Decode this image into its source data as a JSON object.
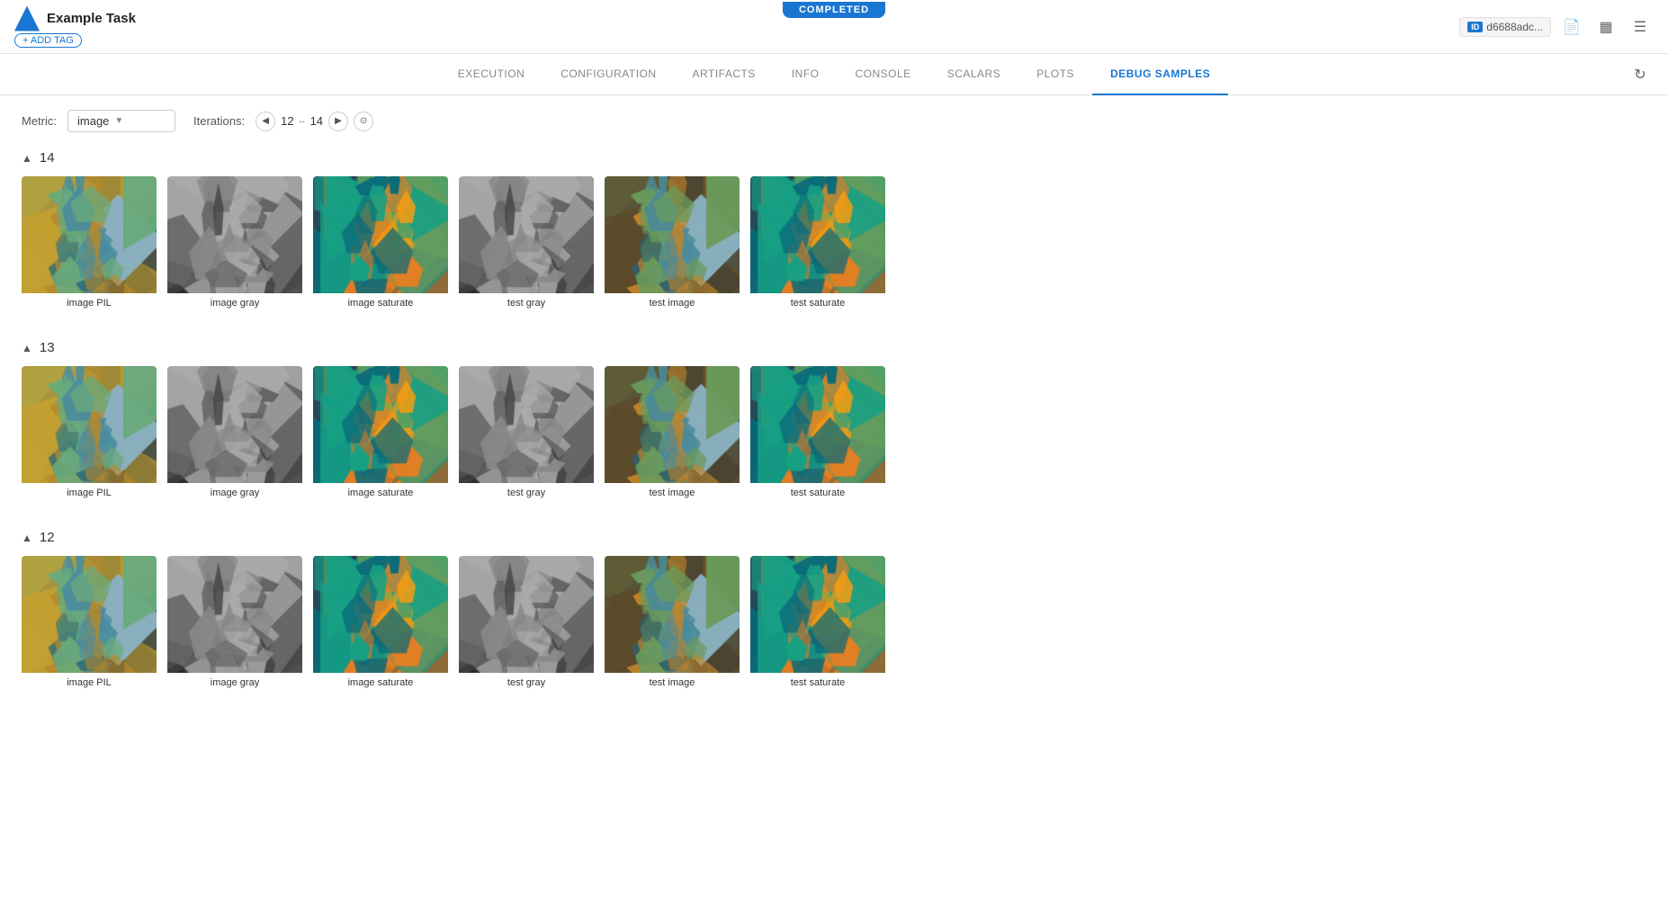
{
  "completed_badge": "COMPLETED",
  "header": {
    "logo_text": "Example Task",
    "add_tag_label": "+ ADD TAG",
    "id_label": "ID",
    "id_value": "d6688adc...",
    "title": "Example Task"
  },
  "nav": {
    "tabs": [
      {
        "id": "execution",
        "label": "EXECUTION",
        "active": false
      },
      {
        "id": "configuration",
        "label": "CONFIGURATION",
        "active": false
      },
      {
        "id": "artifacts",
        "label": "ARTIFACTS",
        "active": false
      },
      {
        "id": "info",
        "label": "INFO",
        "active": false
      },
      {
        "id": "console",
        "label": "CONSOLE",
        "active": false
      },
      {
        "id": "scalars",
        "label": "SCALARS",
        "active": false
      },
      {
        "id": "plots",
        "label": "PLOTS",
        "active": false
      },
      {
        "id": "debug_samples",
        "label": "DEBUG SAMPLES",
        "active": true
      }
    ]
  },
  "metric_bar": {
    "metric_label": "Metric:",
    "metric_value": "image",
    "iterations_label": "Iterations:",
    "iter_from": "12",
    "iter_to": "14"
  },
  "groups": [
    {
      "id": "group-14",
      "number": "14",
      "expanded": true,
      "images": [
        {
          "label": "image PIL",
          "type": "color"
        },
        {
          "label": "image gray",
          "type": "gray"
        },
        {
          "label": "image saturate",
          "type": "saturate"
        },
        {
          "label": "test gray",
          "type": "gray"
        },
        {
          "label": "test image",
          "type": "color2"
        },
        {
          "label": "test saturate",
          "type": "saturate2"
        }
      ]
    },
    {
      "id": "group-13",
      "number": "13",
      "expanded": true,
      "images": [
        {
          "label": "image PIL",
          "type": "color"
        },
        {
          "label": "image gray",
          "type": "gray"
        },
        {
          "label": "image saturate",
          "type": "saturate"
        },
        {
          "label": "test gray",
          "type": "gray"
        },
        {
          "label": "test image",
          "type": "color2"
        },
        {
          "label": "test saturate",
          "type": "saturate2"
        }
      ]
    },
    {
      "id": "group-12",
      "number": "12",
      "expanded": true,
      "images": [
        {
          "label": "image PIL",
          "type": "color"
        },
        {
          "label": "image gray",
          "type": "gray"
        },
        {
          "label": "image saturate",
          "type": "saturate"
        },
        {
          "label": "test gray",
          "type": "gray"
        },
        {
          "label": "test image",
          "type": "color2"
        },
        {
          "label": "test saturate",
          "type": "saturate2"
        }
      ]
    }
  ]
}
